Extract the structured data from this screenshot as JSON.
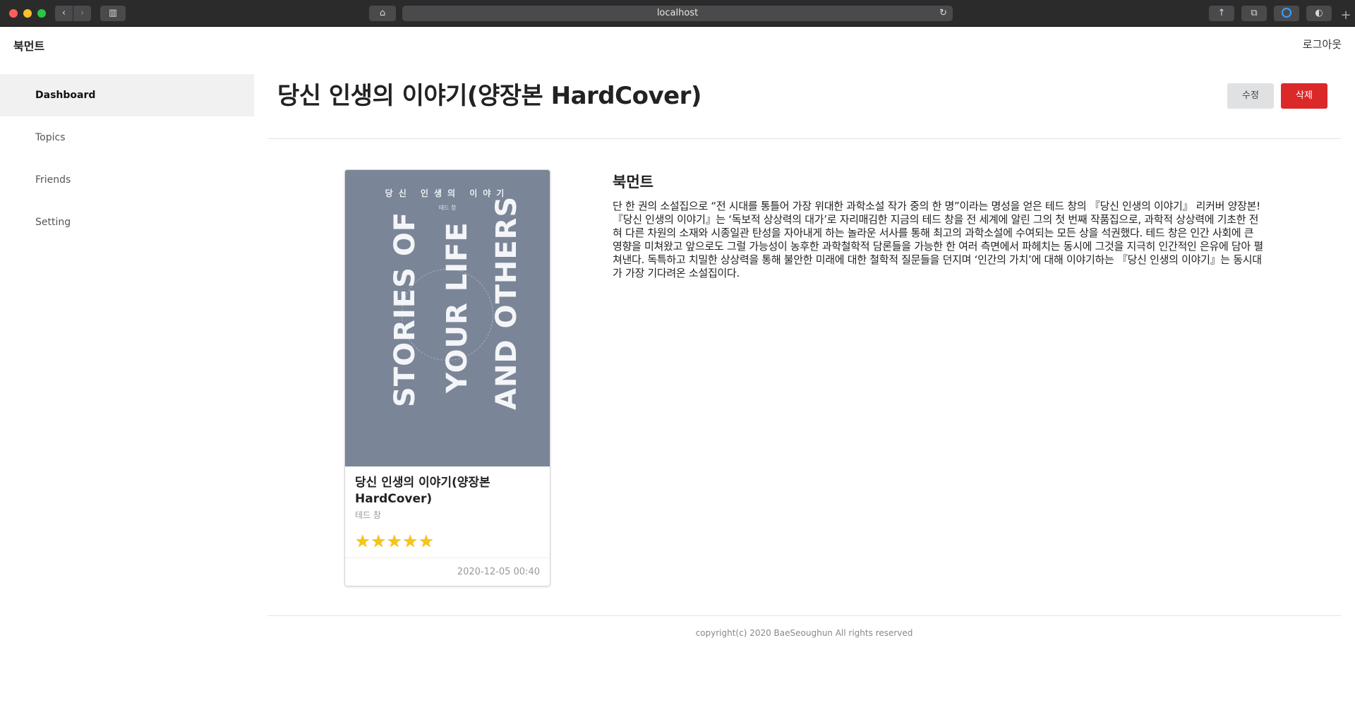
{
  "browser": {
    "url": "localhost"
  },
  "app": {
    "brand": "북먼트",
    "logout_label": "로그아웃"
  },
  "sidebar": {
    "items": [
      {
        "label": "Dashboard",
        "active": true
      },
      {
        "label": "Topics",
        "active": false
      },
      {
        "label": "Friends",
        "active": false
      },
      {
        "label": "Setting",
        "active": false
      }
    ]
  },
  "book": {
    "title": "당신 인생의 이야기(양장본 HardCover)",
    "author": "테드 창",
    "rating": 5,
    "rating_max": 5,
    "date": "2020-12-05 00:40",
    "cover": {
      "korean_title": "당신 인생의 이야기",
      "line1": "STORIES OF",
      "line2": "YOUR LIFE",
      "line3": "AND OTHERS",
      "background": "#7a8597"
    }
  },
  "actions": {
    "edit_label": "수정",
    "delete_label": "삭제",
    "delete_color": "#db2828"
  },
  "review": {
    "heading": "북먼트",
    "text": "단 한 권의 소설집으로 “전 시대를 통틀어 가장 위대한 과학소설 작가 중의 한 명”이라는 명성을 얻은 테드 창의 『당신 인생의 이야기』 리커버 양장본! 『당신 인생의 이야기』는 ‘독보적 상상력의 대가’로 자리매김한 지금의 테드 창을 전 세계에 알린 그의 첫 번째 작품집으로, 과학적 상상력에 기초한 전혀 다른 차원의 소재와 시종일관 탄성을 자아내게 하는 놀라운 서사를 통해 최고의 과학소설에 수여되는 모든 상을 석권했다. 테드 창은 인간 사회에 큰 영향을 미쳐왔고 앞으로도 그럴 가능성이 농후한 과학철학적 담론들을 가능한 한 여러 측면에서 파헤치는 동시에 그것을 지극히 인간적인 은유에 담아 펼쳐낸다. 독특하고 치밀한 상상력을 통해 불안한 미래에 대한 철학적 질문들을 던지며 ‘인간의 가치’에 대해 이야기하는 『당신 인생의 이야기』는 동시대가 가장 기다려온 소설집이다."
  },
  "footer": {
    "copyright": "copyright(c) 2020 BaeSeoughun All rights reserved"
  }
}
